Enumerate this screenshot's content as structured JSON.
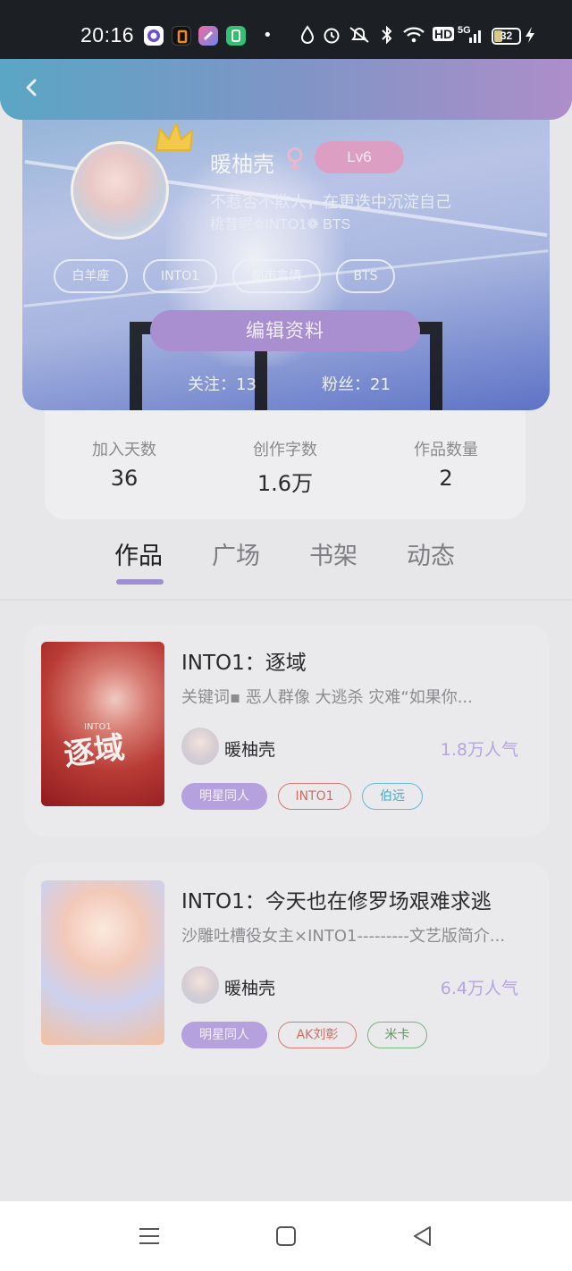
{
  "status_bar": {
    "time": "20:16",
    "icons": [
      "app-icon-purple",
      "app-icon-orange",
      "app-icon-blue",
      "app-icon-green",
      "dot-icon",
      "drop-icon",
      "alarm-icon",
      "silent-icon",
      "bluetooth-icon",
      "wifi-icon"
    ],
    "hd_label": "HD",
    "network_label": "5G",
    "battery": "32"
  },
  "profile": {
    "username": "暖柚壳",
    "gender_symbol": "♀",
    "level": "Lv6",
    "bio_line1": "不惹否不欺人，在更迭中沉淀自己",
    "bio_line2": "桃昔眠❁INTO1❁ BTS",
    "tags": [
      "白羊座",
      "INTO1",
      "都市言情",
      "BTS"
    ],
    "edit_button": "编辑资料",
    "follow_label": "关注：13",
    "fans_label": "粉丝：21"
  },
  "stats": [
    {
      "label": "加入天数",
      "value": "36"
    },
    {
      "label": "创作字数",
      "value": "1.6万"
    },
    {
      "label": "作品数量",
      "value": "2"
    }
  ],
  "tabs": [
    "作品",
    "广场",
    "书架",
    "动态"
  ],
  "active_tab": "作品",
  "works": [
    {
      "title": "INTO1：逐域",
      "description": "关键词▪  恶人群像  大逃杀  灾难“如果你...",
      "author": "暖柚壳",
      "popularity": "1.8万人气",
      "cover_text": "逐域",
      "cover_caption": "INTO1",
      "tags": [
        {
          "label": "明星同人",
          "style": "solid"
        },
        {
          "label": "INTO1",
          "style": "red"
        },
        {
          "label": "伯远",
          "style": "blue"
        }
      ]
    },
    {
      "title": "INTO1：今天也在修罗场艰难求逃",
      "description": "沙雕吐槽役女主×INTO1---------文艺版简介...",
      "author": "暖柚壳",
      "popularity": "6.4万人气",
      "tags": [
        {
          "label": "明星同人",
          "style": "solid"
        },
        {
          "label": "AK刘彰",
          "style": "red"
        },
        {
          "label": "米卡",
          "style": "green"
        }
      ]
    }
  ],
  "nav": [
    "menu-icon",
    "home-icon",
    "back-triangle-icon"
  ]
}
